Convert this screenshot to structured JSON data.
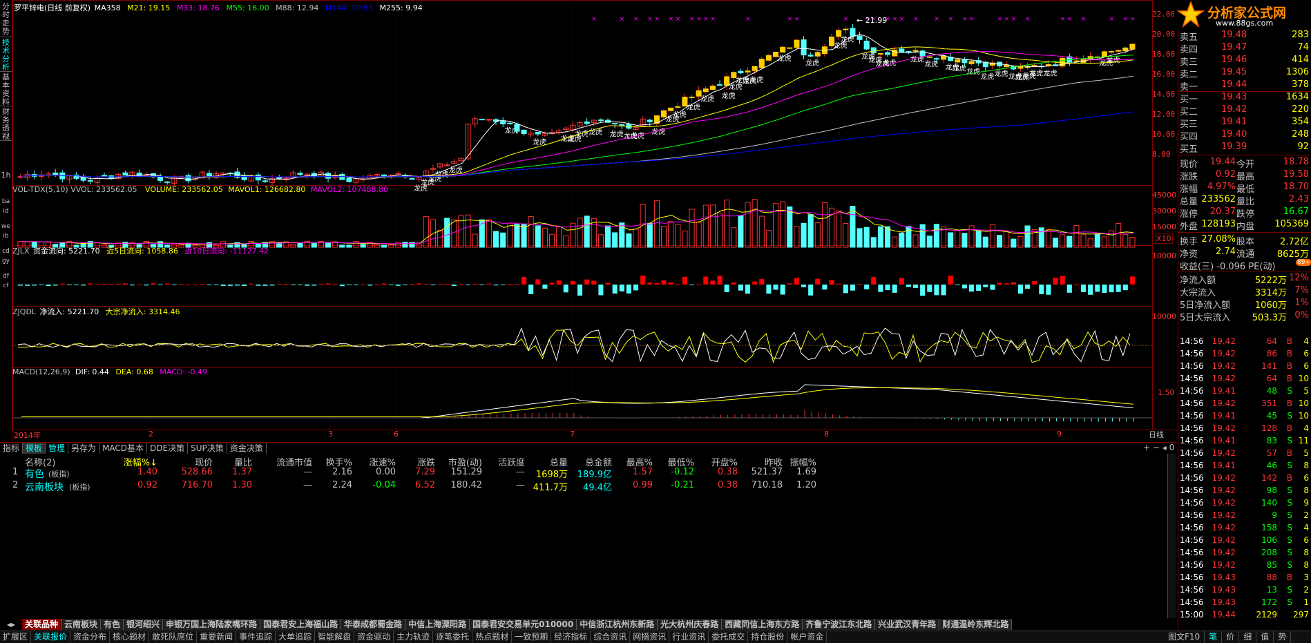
{
  "title": {
    "stock": "罗平锌电",
    "mode": "(日线 前复权)",
    "ma": "MA358"
  },
  "ma_values": [
    {
      "label": "M21: 19.15",
      "color": "#ffff00"
    },
    {
      "label": "M33: 18.76",
      "color": "#ff00ff"
    },
    {
      "label": "M55: 16.00",
      "color": "#00ff00"
    },
    {
      "label": "M88: 12.94",
      "color": "#c0c0c0"
    },
    {
      "label": "M144: 10.93",
      "color": "#0000ff"
    },
    {
      "label": "M255: 9.94",
      "color": "#ffffff"
    }
  ],
  "left_tabs": [
    "分时走势",
    "技术分析",
    "基本资料",
    "财务透视"
  ],
  "left_extra": "1h",
  "price_axis": [
    "22.00",
    "20.00",
    "18.00",
    "16.00",
    "14.00",
    "12.00",
    "10.00",
    "8.00"
  ],
  "max_label": "21.99",
  "candle_tag": "龙虎",
  "vol_panel": {
    "title": "VOL-TDX(5,10)",
    "vvol": "VVOL: 233562.05",
    "volume": "VOLUME: 233562.05",
    "mavol1": "MAVOL1: 126682.80",
    "mavol2": "MAVOL2: 107488.80",
    "axis": [
      "45000",
      "30000",
      "15000"
    ],
    "unit": "X10"
  },
  "zjlx_panel": {
    "title": "ZJLX",
    "flow": "资金流向: 5221.70",
    "d5": "近5日流向: 1058.86",
    "d10": "近10日流向: -11127.42",
    "axis": [
      "10000"
    ]
  },
  "zjqdl_panel": {
    "title": "ZJQDL",
    "net": "净流入: 5221.70",
    "big": "大宗净流入: 3314.46",
    "axis": [
      "10000"
    ]
  },
  "macd_panel": {
    "title": "MACD(12,26,9)",
    "dif": "DIF: 0.44",
    "dea": "DEA: 0.68",
    "macd": "MACD: -0.49",
    "axis": [
      "1.50"
    ]
  },
  "left_side_labels": [
    "ba",
    "id",
    "we",
    "ib",
    "cd",
    "gy",
    "df",
    "cf"
  ],
  "time_axis": {
    "year": "2014年",
    "months": [
      "2",
      "3",
      "6",
      "7",
      "8",
      "9"
    ],
    "period": "日线"
  },
  "bottom_tabs": [
    "指标",
    "模板",
    "管理",
    "另存为",
    "MACD基本",
    "DDE决策",
    "SUP决策",
    "资金决策"
  ],
  "quote": {
    "sell": [
      [
        "卖五",
        "19.48",
        "283"
      ],
      [
        "卖四",
        "19.47",
        "74"
      ],
      [
        "卖三",
        "19.46",
        "414"
      ],
      [
        "卖二",
        "19.45",
        "1306"
      ],
      [
        "卖一",
        "19.44",
        "378"
      ]
    ],
    "buy": [
      [
        "买一",
        "19.43",
        "1634"
      ],
      [
        "买二",
        "19.42",
        "220"
      ],
      [
        "买三",
        "19.41",
        "354"
      ],
      [
        "买四",
        "19.40",
        "248"
      ],
      [
        "买五",
        "19.39",
        "92"
      ]
    ],
    "stats": [
      [
        "现价",
        "19.44",
        "今开",
        "18.78"
      ],
      [
        "涨跌",
        "0.92",
        "最高",
        "19.58"
      ],
      [
        "涨幅",
        "4.97%",
        "最低",
        "18.70"
      ],
      [
        "总量",
        "233562",
        "量比",
        "2.43"
      ],
      [
        "涨停",
        "20.37",
        "跌停",
        "16.67"
      ],
      [
        "外盘",
        "128193",
        "内盘",
        "105369"
      ]
    ],
    "stats2": [
      [
        "换手",
        "27.08%",
        "股本",
        "2.72亿"
      ],
      [
        "净资",
        "2.74",
        "流通",
        "8625万"
      ]
    ],
    "eps": "收益(三) -0.096 PE(动)",
    "badge": "89+",
    "flows": [
      [
        "净流入额",
        "5222万",
        "12%"
      ],
      [
        "大宗流入",
        "3314万",
        "7%"
      ],
      [
        "5日净流入额",
        "1060万",
        "1%"
      ],
      [
        "5日大宗流入",
        "503.3万",
        "0%"
      ]
    ]
  },
  "ticks": [
    [
      "14:56",
      "19.42",
      "64",
      "B",
      "4"
    ],
    [
      "14:56",
      "19.42",
      "86",
      "B",
      "6"
    ],
    [
      "14:56",
      "19.42",
      "141",
      "B",
      "6"
    ],
    [
      "14:56",
      "19.42",
      "64",
      "B",
      "10"
    ],
    [
      "14:56",
      "19.41",
      "48",
      "S",
      "5"
    ],
    [
      "14:56",
      "19.42",
      "351",
      "B",
      "10"
    ],
    [
      "14:56",
      "19.41",
      "45",
      "S",
      "10"
    ],
    [
      "14:56",
      "19.42",
      "128",
      "B",
      "4"
    ],
    [
      "14:56",
      "19.41",
      "83",
      "S",
      "11"
    ],
    [
      "14:56",
      "19.42",
      "57",
      "B",
      "5"
    ],
    [
      "14:56",
      "19.41",
      "46",
      "S",
      "8"
    ],
    [
      "14:56",
      "19.42",
      "142",
      "B",
      "6"
    ],
    [
      "14:56",
      "19.42",
      "98",
      "S",
      "8"
    ],
    [
      "14:56",
      "19.42",
      "140",
      "S",
      "9"
    ],
    [
      "14:56",
      "19.42",
      "9",
      "S",
      "2"
    ],
    [
      "14:56",
      "19.42",
      "158",
      "S",
      "4"
    ],
    [
      "14:56",
      "19.42",
      "106",
      "S",
      "6"
    ],
    [
      "14:56",
      "19.42",
      "208",
      "S",
      "8"
    ],
    [
      "14:56",
      "19.42",
      "85",
      "S",
      "8"
    ],
    [
      "14:56",
      "19.43",
      "88",
      "B",
      "3"
    ],
    [
      "14:56",
      "19.43",
      "13",
      "S",
      "2"
    ],
    [
      "14:56",
      "19.43",
      "172",
      "S",
      "1"
    ],
    [
      "15:00",
      "19.44",
      "2129",
      "",
      "297"
    ]
  ],
  "table": {
    "headers": [
      "名称(2)",
      "涨幅%↓",
      "现价",
      "量比",
      "流通市值",
      "换手%",
      "涨速%",
      "涨跌",
      "市盈(动)",
      "活跃度",
      "总量",
      "总金额",
      "最高%",
      "最低%",
      "开盘%",
      "昨收",
      "振幅%"
    ],
    "rows": [
      {
        "idx": "1",
        "name": "有色",
        "tag": "(板指)",
        "cells": [
          "1.40",
          "528.66",
          "1.37",
          "—",
          "2.16",
          "0.00",
          "7.29",
          "151.29",
          "—",
          "1698万",
          "189.9亿",
          "1.57",
          "-0.12",
          "0.38",
          "521.37",
          "1.69"
        ]
      },
      {
        "idx": "2",
        "name": "云南板块",
        "tag": "(板指)",
        "cells": [
          "0.92",
          "716.70",
          "1.30",
          "—",
          "2.24",
          "-0.04",
          "6.52",
          "180.42",
          "—",
          "411.7万",
          "49.4亿",
          "0.99",
          "-0.21",
          "0.38",
          "710.18",
          "1.20"
        ]
      }
    ]
  },
  "group_tabs": [
    "关联品种",
    "云南板块",
    "有色",
    "银河绍兴",
    "申银万国上海陆家嘴环路",
    "国泰君安上海福山路",
    "华泰成都蜀金路",
    "中信上海溧阳路",
    "国泰君安交易单元010000",
    "中信浙江杭州东新路",
    "光大杭州庆春路",
    "西藏同信上海东方路",
    "齐鲁宁波江东北路",
    "兴业武汉青年路",
    "财通温岭东辉北路"
  ],
  "status_tabs": [
    "扩展区",
    "关联报价",
    "资金分布",
    "核心题材",
    "敢死队席位",
    "重要新闻",
    "事件追踪",
    "大单追踪",
    "智能解盘",
    "资金驱动",
    "主力轨迹",
    "逐笔委托",
    "热点题材",
    "一致预期",
    "经济指标",
    "综合资讯",
    "网摘资讯",
    "行业资讯",
    "委托成交",
    "持仓股份",
    "帐户资金"
  ],
  "status_right": [
    "图文F10",
    "笔",
    "价",
    "细",
    "值",
    "势"
  ],
  "logo": {
    "title": "分析家公式网",
    "url": "www.88gs.com"
  },
  "colors": {
    "up": "#ff3232",
    "down": "#54ffff",
    "yellow": "#ffff00",
    "magenta": "#ff00ff",
    "green": "#00ff00",
    "border": "#800000"
  }
}
